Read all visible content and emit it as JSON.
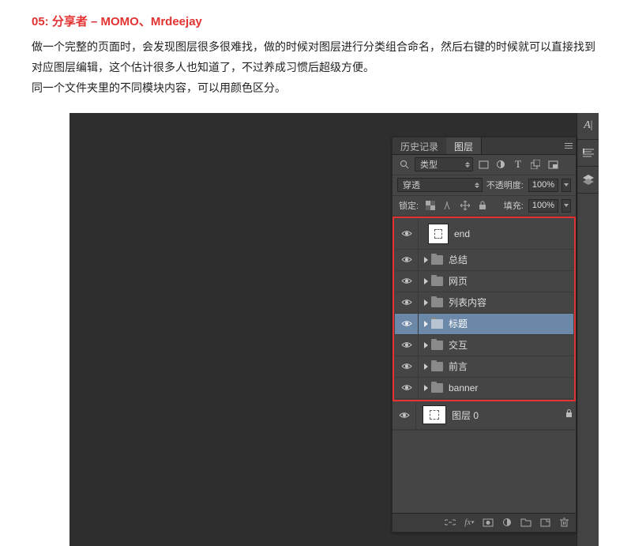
{
  "article": {
    "title": "05: 分享者 – MOMO、Mrdeejay",
    "p1": "做一个完整的页面时，会发现图层很多很难找，做的时候对图层进行分类组合命名，然后右键的时候就可以直接找到对应图层编辑，这个估计很多人也知道了，不过养成习惯后超级方便。",
    "p2": "同一个文件夹里的不同模块内容，可以用颜色区分。"
  },
  "panel": {
    "tabs": {
      "history": "历史记录",
      "layers": "图层"
    },
    "typeFilter": "类型",
    "blendMode": "穿透",
    "opacityLabel": "不透明度:",
    "opacityValue": "100%",
    "lockLabel": "锁定:",
    "fillLabel": "填充:",
    "fillValue": "100%"
  },
  "layers": {
    "end": "end",
    "g1": "总结",
    "g2": "网页",
    "g3": "列表内容",
    "g4": "标题",
    "g5": "交互",
    "g6": "前言",
    "g7": "banner",
    "layer0": "图层 0"
  },
  "right": {
    "char": "A|"
  }
}
